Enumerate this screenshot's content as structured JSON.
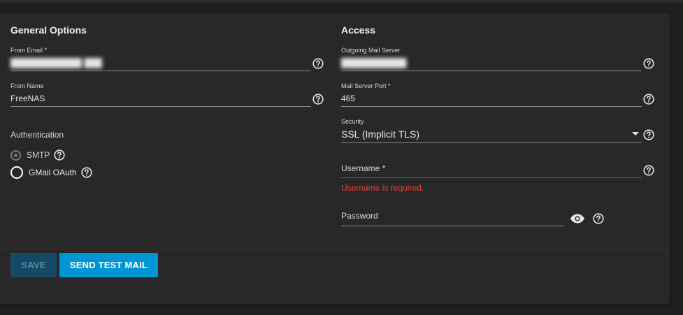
{
  "general": {
    "title": "General Options",
    "from_email_label": "From Email *",
    "from_email_value": "████████████ ███",
    "from_name_label": "From Name",
    "from_name_value": "FreeNAS",
    "auth_title": "Authentication",
    "auth_options": [
      {
        "label": "SMTP",
        "selected": true
      },
      {
        "label": "GMail OAuth",
        "selected": false
      }
    ]
  },
  "access": {
    "title": "Access",
    "outgoing_label": "Outgoing Mail Server",
    "outgoing_value": "███████████",
    "port_label": "Mail Server Port *",
    "port_value": "465",
    "security_label": "Security",
    "security_value": "SSL (Implicit TLS)",
    "username_label": "Username *",
    "username_error": "Username is required.",
    "password_label": "Password"
  },
  "actions": {
    "save_label": "SAVE",
    "test_label": "SEND TEST MAIL"
  },
  "colors": {
    "accent": "#0095d5",
    "error": "#e0443e",
    "card": "#282828"
  }
}
